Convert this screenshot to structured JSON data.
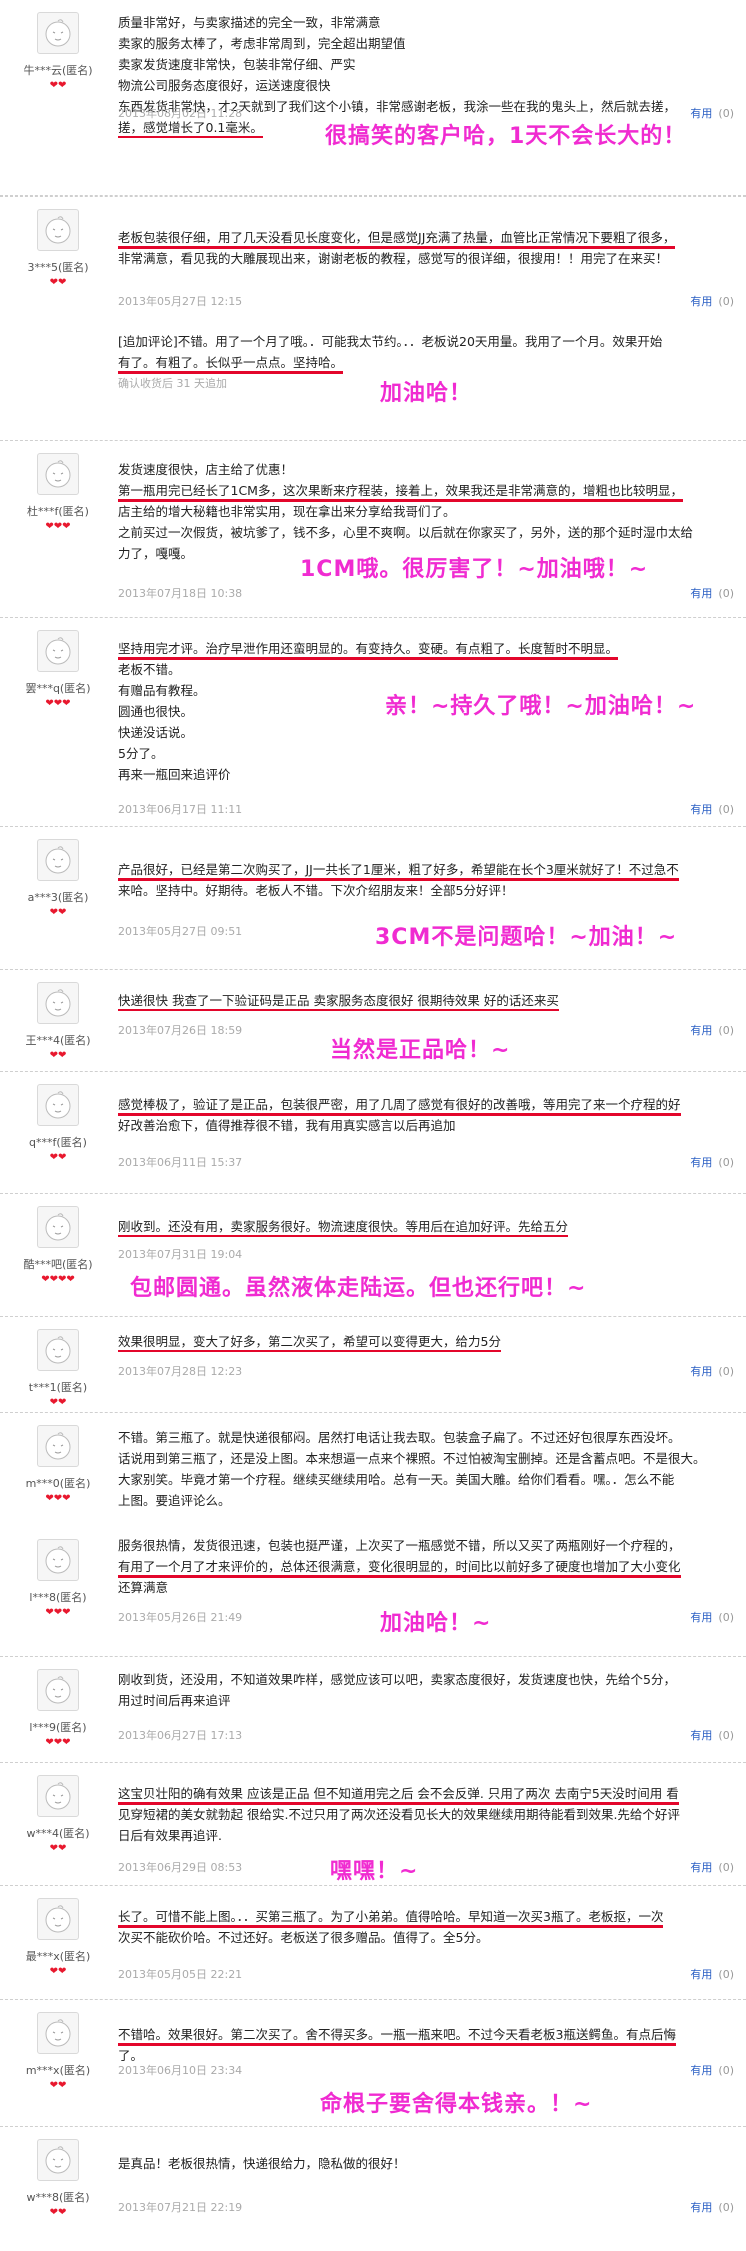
{
  "useful_label": "有用",
  "useful_count": "(0)",
  "reviews": [
    {
      "user": "牛***云(匿名)",
      "hearts": "❤❤",
      "lines": [
        "质量非常好，与卖家描述的完全一致，非常满意",
        "卖家的服务太棒了，考虑非常周到，完全超出期望值",
        "卖家发货速度非常快，包装非常仔细、严实",
        "物流公司服务态度很好，运送速度很快",
        "东西发货非常快，才2天就到了我们这个小镇，非常感谢老板，我涂一些在我的鬼头上，然后就去搓，",
        "搓，感觉增长了0.1毫米。"
      ],
      "date": "2013年08月02日 11:28",
      "annotation": "很搞笑的客户哈，1天不会长大的！"
    },
    {
      "user": "3***5(匿名)",
      "hearts": "❤❤",
      "lines": [
        "老板包装很仔细，用了几天没看见长度变化，但是感觉JJ充满了热量，血管比正常情况下要粗了很多，",
        "非常满意，看见我的大雕展现出来，谢谢老板的教程，感觉写的很详细，很搜用！！用完了在来买！"
      ],
      "date": "2013年05月27日 12:15",
      "followup": [
        "[追加评论]不错。用了一个月了哦。．可能我太节约。．．老板说20天用量。我用了一个月。效果开始",
        "有了。有粗了。长似乎一点点。坚持哈。"
      ],
      "confirm": "确认收货后 31 天追加",
      "annotation": "加油哈！"
    },
    {
      "user": "杜***f(匿名)",
      "hearts": "❤❤❤",
      "lines": [
        "发货速度很快，店主给了优惠！",
        "第一瓶用完已经长了1CM多，这次果断来疗程装，接着上，效果我还是非常满意的，增粗也比较明显，",
        "店主给的增大秘籍也非常实用，现在拿出来分享给我哥们了。",
        "之前买过一次假货，被坑爹了，钱不多，心里不爽啊。以后就在你家买了，另外，送的那个延时湿巾太给",
        "力了，嘎嘎。"
      ],
      "date": "2013年07月18日 10:38",
      "annotation": "1CM哦。很厉害了！~加油哦！~"
    },
    {
      "user": "罢***q(匿名)",
      "hearts": "❤❤❤",
      "lines": [
        "坚持用完才评。治疗早泄作用还蛮明显的。有变持久。变硬。有点粗了。长度暂时不明显。",
        "老板不错。",
        "有赠品有教程。",
        "圆通也很快。",
        "快递没话说。",
        "5分了。",
        "再来一瓶回来追评价"
      ],
      "date": "2013年06月17日 11:11",
      "annotation": "亲！~持久了哦！~加油哈！~"
    },
    {
      "user": "a***3(匿名)",
      "hearts": "❤❤",
      "lines": [
        "产品很好，已经是第二次购买了，JJ一共长了1厘米，粗了好多，希望能在长个3厘米就好了！不过急不",
        "来哈。坚持中。好期待。老板人不错。下次介绍朋友来！全部5分好评！"
      ],
      "date": "2013年05月27日 09:51",
      "annotation": "3CM不是问题哈！~加油！~"
    },
    {
      "user": "王***4(匿名)",
      "hearts": "❤❤",
      "lines": [
        "快递很快 我查了一下验证码是正品 卖家服务态度很好 很期待效果 好的话还来买"
      ],
      "date": "2013年07月26日 18:59",
      "annotation": "当然是正品哈！~"
    },
    {
      "user": "q***f(匿名)",
      "hearts": "❤❤",
      "lines": [
        "感觉棒极了，验证了是正品，包装很严密，用了几周了感觉有很好的改善哦，等用完了来一个疗程的好",
        "好改善治愈下，值得推荐很不错，我有用真实感言以后再追加"
      ],
      "date": "2013年06月11日 15:37"
    },
    {
      "user": "酷***吧(匿名)",
      "hearts": "❤❤❤❤",
      "lines": [
        "刚收到。还没有用，卖家服务很好。物流速度很快。等用后在追加好评。先给五分"
      ],
      "date": "2013年07月31日 19:04",
      "annotation": "包邮圆通。虽然液体走陆运。但也还行吧！~"
    },
    {
      "user": "t***1(匿名)",
      "hearts": "❤❤",
      "lines": [
        "效果很明显，变大了好多，第二次买了，希望可以变得更大，给力5分"
      ],
      "date": "2013年07月28日 12:23"
    },
    {
      "user": "m***0(匿名)",
      "hearts": "❤❤❤",
      "lines": [
        "不错。第三瓶了。就是快递很郁闷。居然打电话让我去取。包装盒子扁了。不过还好包很厚东西没坏。",
        "话说用到第三瓶了，还是没上图。本来想逼一点来个裸照。不过怕被淘宝删掉。还是含蓄点吧。不是很大。",
        "大家别笑。毕竟才第一个疗程。继续买继续用哈。总有一天。美国大雕。给你们看看。嘿。．怎么不能",
        "上图。要追评论么。"
      ],
      "date": ""
    },
    {
      "user": "l***8(匿名)",
      "hearts": "❤❤❤",
      "lines": [
        "服务很热情，发货很迅速，包装也挺严谨，上次买了一瓶感觉不错，所以又买了两瓶刚好一个疗程的，",
        "有用了一个月了才来评价的，总体还很满意，变化很明显的，时间比以前好多了硬度也增加了大小变化",
        "还算满意"
      ],
      "date": "2013年05月26日 21:49",
      "annotation": "加油哈！~"
    },
    {
      "user": "l***9(匿名)",
      "hearts": "❤❤❤",
      "lines": [
        "刚收到货，还没用，不知道效果咋样，感觉应该可以吧，卖家态度很好，发货速度也快，先给个5分，",
        "用过时间后再来追评"
      ],
      "date": "2013年06月27日 17:13"
    },
    {
      "user": "w***4(匿名)",
      "hearts": "❤❤",
      "lines": [
        "这宝贝壮阳的确有效果 应该是正品 但不知道用完之后 会不会反弹. 只用了两次 去南宁5天没时间用 看",
        "见穿短裙的美女就勃起 很给实.不过只用了两次还没看见长大的效果继续用期待能看到效果.先给个好评",
        "日后有效果再追评."
      ],
      "date": "2013年06月29日 08:53",
      "annotation": "嘿嘿！~"
    },
    {
      "user": "最***x(匿名)",
      "hearts": "❤❤",
      "lines": [
        "长了。可惜不能上图。．．买第三瓶了。为了小弟弟。值得哈哈。早知道一次买3瓶了。老板抠，一次",
        "次买不能砍价哈。不过还好。老板送了很多赠品。值得了。全5分。"
      ],
      "date": "2013年05月05日 22:21"
    },
    {
      "user": "m***x(匿名)",
      "hearts": "❤❤",
      "lines": [
        "不错哈。效果很好。第二次买了。舍不得买多。一瓶一瓶来吧。不过今天看老板3瓶送鳄鱼。有点后悔",
        "了。"
      ],
      "date": "2013年06月10日 23:34",
      "annotation": "命根子要舍得本钱亲。！~"
    },
    {
      "user": "w***8(匿名)",
      "hearts": "❤❤",
      "lines": [
        "是真品！老板很热情，快递很给力，隐私做的很好！"
      ],
      "date": "2013年07月21日 22:19"
    }
  ]
}
